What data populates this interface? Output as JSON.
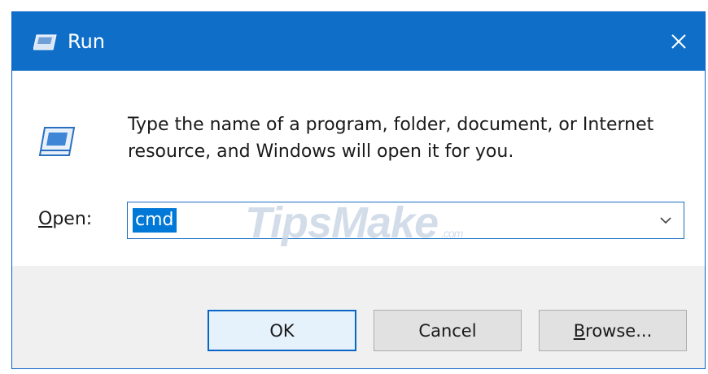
{
  "window": {
    "title": "Run",
    "icon": "run-app-icon",
    "close_icon": "close-icon"
  },
  "body": {
    "description": "Type the name of a program, folder, document, or Internet resource, and Windows will open it for you.",
    "icon": "run-program-icon",
    "open_label_accel": "O",
    "open_label_rest": "pen:",
    "input_value": "cmd",
    "dropdown_icon": "chevron-down-icon"
  },
  "watermark": {
    "brand": "TipsMake",
    "suffix": ".com"
  },
  "buttons": {
    "ok": "OK",
    "cancel": "Cancel",
    "browse_accel": "B",
    "browse_rest": "rowse..."
  },
  "colors": {
    "titlebar": "#0f6fc8",
    "selection": "#0078d7",
    "footer": "#f0f0f0",
    "default_button_border": "#0a66c6"
  }
}
